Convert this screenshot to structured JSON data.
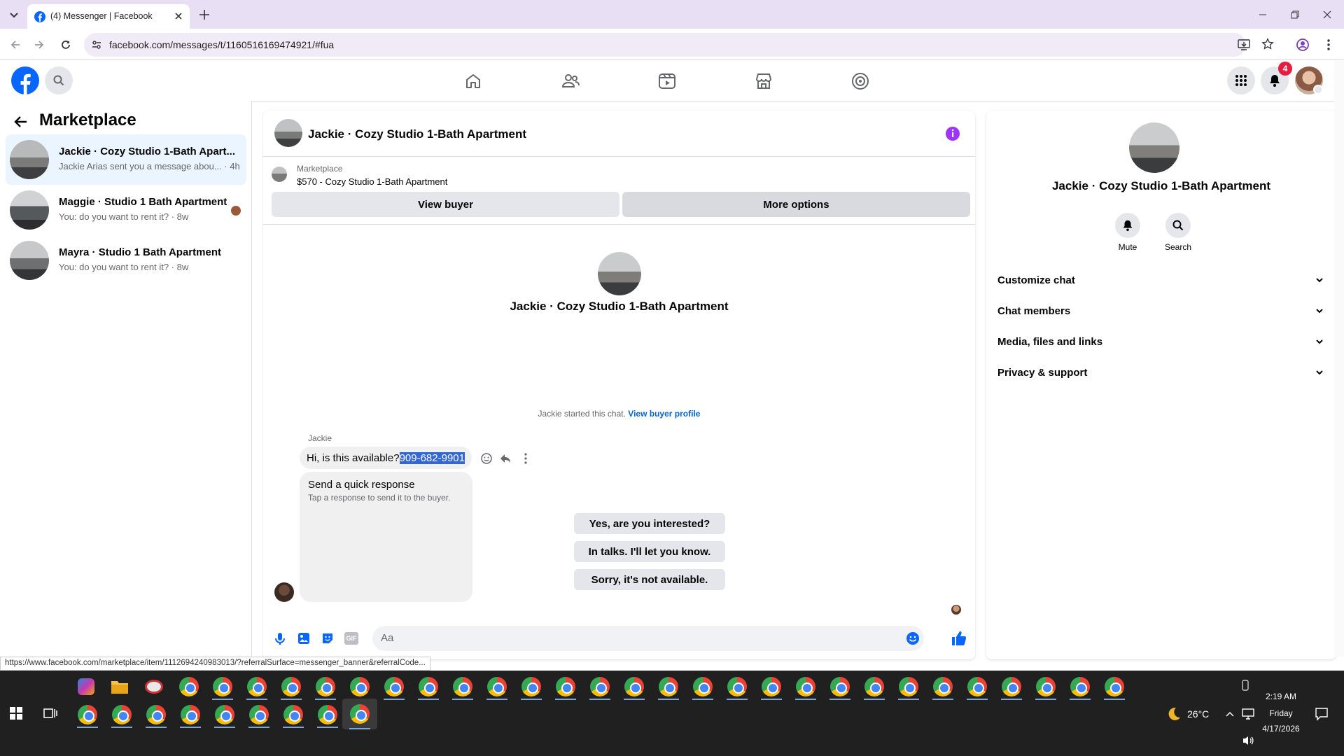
{
  "browser": {
    "tab_title": "(4) Messenger | Facebook",
    "url": "facebook.com/messages/t/1160516169474921/#fua",
    "status_url": "https://www.facebook.com/marketplace/item/1112694240983013/?referralSurface=messenger_banner&referralCode..."
  },
  "header": {
    "notification_count": "4",
    "brand_color": "#0866ff"
  },
  "sidebar": {
    "title": "Marketplace",
    "conversations": [
      {
        "title": "Jackie · Cozy Studio 1-Bath Apart...",
        "preview": "Jackie Arias sent you a message abou... · 4h"
      },
      {
        "title": "Maggie · Studio 1 Bath Apartment",
        "preview": "You: do you want to rent it? · 8w"
      },
      {
        "title": "Mayra · Studio 1 Bath Apartment",
        "preview": "You: do you want to rent it? · 8w"
      }
    ]
  },
  "chat": {
    "title": "Jackie · Cozy Studio 1-Bath Apartment",
    "listing_label": "Marketplace",
    "listing_price_title": "$570 - Cozy Studio 1-Bath Apartment",
    "view_buyer": "View buyer",
    "more_options": "More options",
    "profile_name": "Jackie · Cozy Studio 1-Bath Apartment",
    "started_text": "Jackie started this chat.",
    "view_buyer_profile": "View buyer profile",
    "sender": "Jackie",
    "message_text": "Hi, is this available?",
    "message_highlight": "909-682-9901",
    "quick_title": "Send a quick response",
    "quick_sub": "Tap a response to send it to the buyer.",
    "quick_responses": [
      "Yes, are you interested?",
      "In talks. I'll let you know.",
      "Sorry, it's not available."
    ],
    "composer_placeholder": "Aa"
  },
  "details": {
    "name": "Jackie · Cozy Studio 1-Bath Apartment",
    "mute": "Mute",
    "search": "Search",
    "sections": [
      "Customize chat",
      "Chat members",
      "Media, files and links",
      "Privacy & support"
    ]
  },
  "taskbar": {
    "time": "2:19 AM",
    "day": "Friday",
    "date": "4/17/2026",
    "temperature": "26°C"
  }
}
